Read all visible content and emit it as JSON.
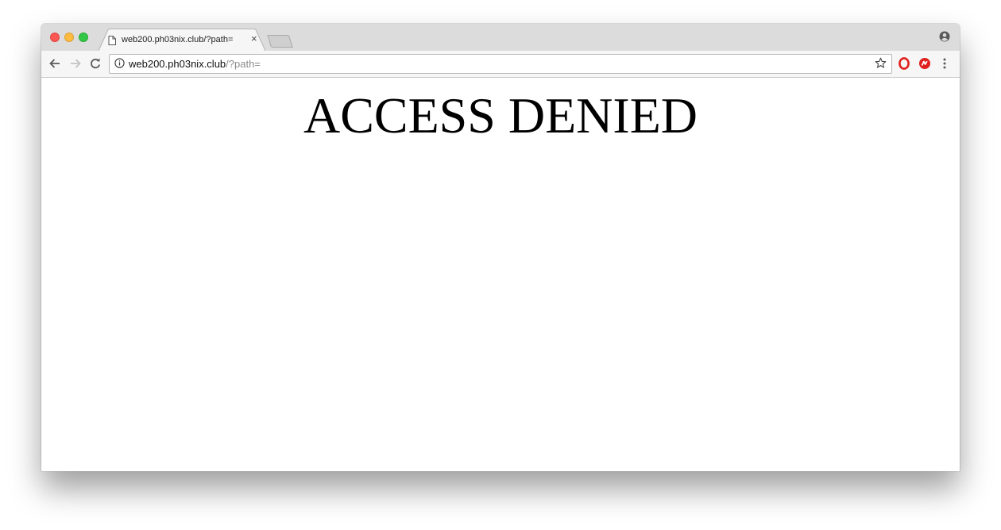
{
  "browser": {
    "tab": {
      "title": "web200.ph03nix.club/?path=",
      "close_glyph": "×"
    },
    "address_bar": {
      "host": "web200.ph03nix.club",
      "path": "/?path="
    },
    "icons": {
      "page": "page-icon",
      "info": "info-icon",
      "star": "bookmark-star-icon",
      "profile": "profile-icon",
      "opera_ext": "opera-extension-icon",
      "red_ext": "red-extension-icon",
      "menu": "menu-dots-icon"
    },
    "colors": {
      "close": "#fc5753",
      "minimize": "#fdbc40",
      "maximize": "#33c748",
      "extension_red": "#e0201d"
    }
  },
  "page": {
    "heading": "ACCESS DENIED"
  }
}
